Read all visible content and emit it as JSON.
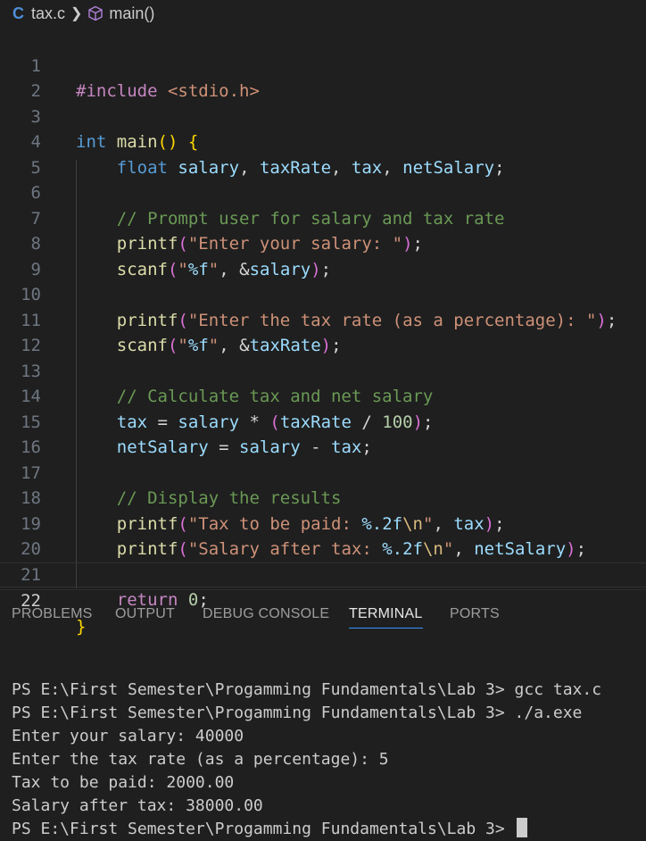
{
  "breadcrumb": {
    "lang_icon": "C",
    "file": "tax.c",
    "symbol": "main()",
    "symbol_icon": "cube-icon"
  },
  "editor": {
    "active_line": 22,
    "lines": [
      {
        "n": "1"
      },
      {
        "n": "2"
      },
      {
        "n": "3"
      },
      {
        "n": "4"
      },
      {
        "n": "5"
      },
      {
        "n": "6"
      },
      {
        "n": "7"
      },
      {
        "n": "8"
      },
      {
        "n": "9"
      },
      {
        "n": "10"
      },
      {
        "n": "11"
      },
      {
        "n": "12"
      },
      {
        "n": "13"
      },
      {
        "n": "14"
      },
      {
        "n": "15"
      },
      {
        "n": "16"
      },
      {
        "n": "17"
      },
      {
        "n": "18"
      },
      {
        "n": "19"
      },
      {
        "n": "20"
      },
      {
        "n": "21"
      },
      {
        "n": "22"
      }
    ],
    "code": {
      "l1_pre": "#include",
      "l1_hdr": " <stdio.h>",
      "l3_kw": "int",
      "l3_fn": "main",
      "l4_kw": "float",
      "l4_v1": "salary",
      "l4_v2": "taxRate",
      "l4_v3": "tax",
      "l4_v4": "netSalary",
      "l6_cmt": "// Prompt user for salary and tax rate",
      "l7_fn": "printf",
      "l7_str": "\"Enter your salary: \"",
      "l8_fn": "scanf",
      "l8_str": "\"",
      "l8_fmt": "%f",
      "l8_str2": "\"",
      "l8_amp": "&",
      "l8_var": "salary",
      "l10_fn": "printf",
      "l10_str": "\"Enter the tax rate (as a percentage): \"",
      "l11_fn": "scanf",
      "l11_str": "\"",
      "l11_fmt": "%f",
      "l11_str2": "\"",
      "l11_amp": "&",
      "l11_var": "taxRate",
      "l13_cmt": "// Calculate tax and net salary",
      "l14_v1": "tax",
      "l14_v2": "salary",
      "l14_v3": "taxRate",
      "l14_num": "100",
      "l15_v1": "netSalary",
      "l15_v2": "salary",
      "l15_v3": "tax",
      "l17_cmt": "// Display the results",
      "l18_fn": "printf",
      "l18_str": "\"Tax to be paid: ",
      "l18_fmt": "%.2f",
      "l18_esc": "\\n",
      "l18_str2": "\"",
      "l18_var": "tax",
      "l19_fn": "printf",
      "l19_str": "\"Salary after tax: ",
      "l19_fmt": "%.2f",
      "l19_esc": "\\n",
      "l19_str2": "\"",
      "l19_var": "netSalary",
      "l21_kw": "return",
      "l21_num": "0"
    }
  },
  "panel": {
    "tabs": [
      "PROBLEMS",
      "OUTPUT",
      "DEBUG CONSOLE",
      "TERMINAL",
      "PORTS"
    ],
    "active_tab": "TERMINAL"
  },
  "terminal": {
    "lines": [
      "PS E:\\First Semester\\Progamming Fundamentals\\Lab 3> gcc tax.c",
      "PS E:\\First Semester\\Progamming Fundamentals\\Lab 3> ./a.exe",
      "Enter your salary: 40000",
      "Enter the tax rate (as a percentage): 5",
      "Tax to be paid: 2000.00",
      "Salary after tax: 38000.00"
    ],
    "prompt": "PS E:\\First Semester\\Progamming Fundamentals\\Lab 3> "
  },
  "colors": {
    "background": "#1f1f1f",
    "accent": "#3794ff"
  }
}
